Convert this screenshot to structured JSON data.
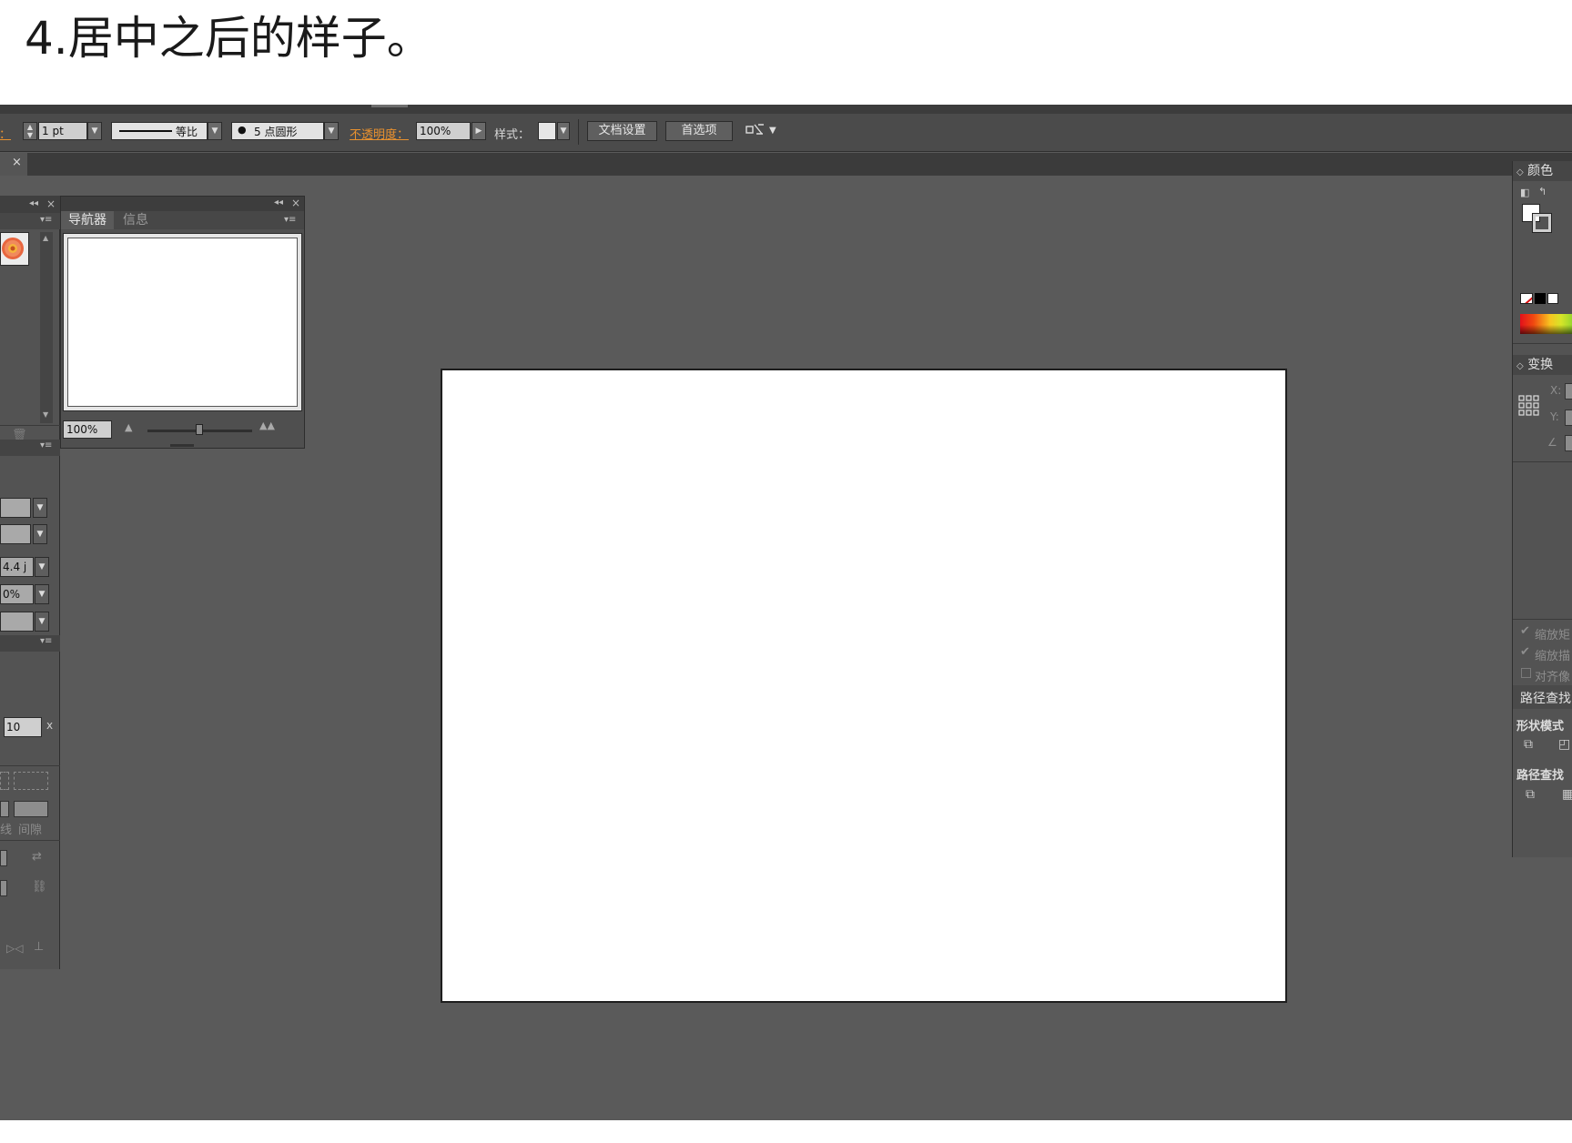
{
  "caption": "4.居中之后的样子。",
  "toolbar": {
    "stroke_label": "边：",
    "stroke_weight": "1 pt",
    "stroke_profile": "等比",
    "brush": "5 点圆形",
    "opacity_label": "不透明度：",
    "opacity_value": "100%",
    "style_label": "样式：",
    "doc_setup_button": "文档设置",
    "preferences_button": "首选项"
  },
  "tab": {
    "close": "×"
  },
  "navigator": {
    "tabs": [
      "导航器",
      "信息"
    ],
    "zoom": "100%"
  },
  "left_panel": {
    "field_a": "4.4 j",
    "field_b": "0%",
    "field_c": "10",
    "unit_x": "x",
    "gap_label": "间隙",
    "line_label": "线"
  },
  "right_panel": {
    "color_title": "颜色",
    "transform_title": "变换",
    "x_label": "X:",
    "y_label": "Y:",
    "check_scale_rect": "缩放矩",
    "check_scale_stroke": "缩放描",
    "check_align_pixel": "对齐像",
    "pathfinder_title": "路径查找",
    "shape_modes": "形状模式",
    "pathfinders": "路径查找"
  },
  "colors": {
    "workspace": "#5a5a5a",
    "panel": "#535353",
    "toolbar": "#4b4b4b",
    "accent_orange": "#e8912f",
    "artboard": "#ffffff"
  }
}
